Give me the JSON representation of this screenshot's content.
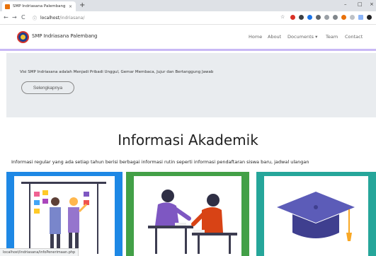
{
  "browser": {
    "tab_title": "SMP Indriasana Palembang",
    "tab_close": "×",
    "new_tab": "+",
    "url_host": "localhost",
    "url_path": "/indriasana/",
    "back": "←",
    "forward": "→",
    "reload": "C",
    "info": "ⓘ",
    "minimize": "–",
    "maximize": "□",
    "close": "×",
    "status_url": "localhost/indriasana/infoPenerimaan.php"
  },
  "navbar": {
    "brand": "SMP Indriasana Palembang",
    "items": [
      "Home",
      "About",
      "Documents ▾",
      "Team",
      "Contact"
    ]
  },
  "jumbotron": {
    "text": "Visi SMP Indriasana adalah Menjadi Pribadi Unggul, Gemar Membaca, Jujur dan Bertanggung Jawab",
    "button": "Selengkapnya"
  },
  "section": {
    "title": "Informasi Akademik",
    "description": "Informasi regular yang ada setiap tahun berisi berbagai informasi rutin seperti informasi pendaftaran siswa baru, jadwal ulangan"
  },
  "cards": [
    {
      "color": "#1e88e5",
      "illustration": "people-presenting-board"
    },
    {
      "color": "#43a047",
      "illustration": "students-taking-exam"
    },
    {
      "color": "#26a69a",
      "illustration": "graduation-cap"
    }
  ]
}
